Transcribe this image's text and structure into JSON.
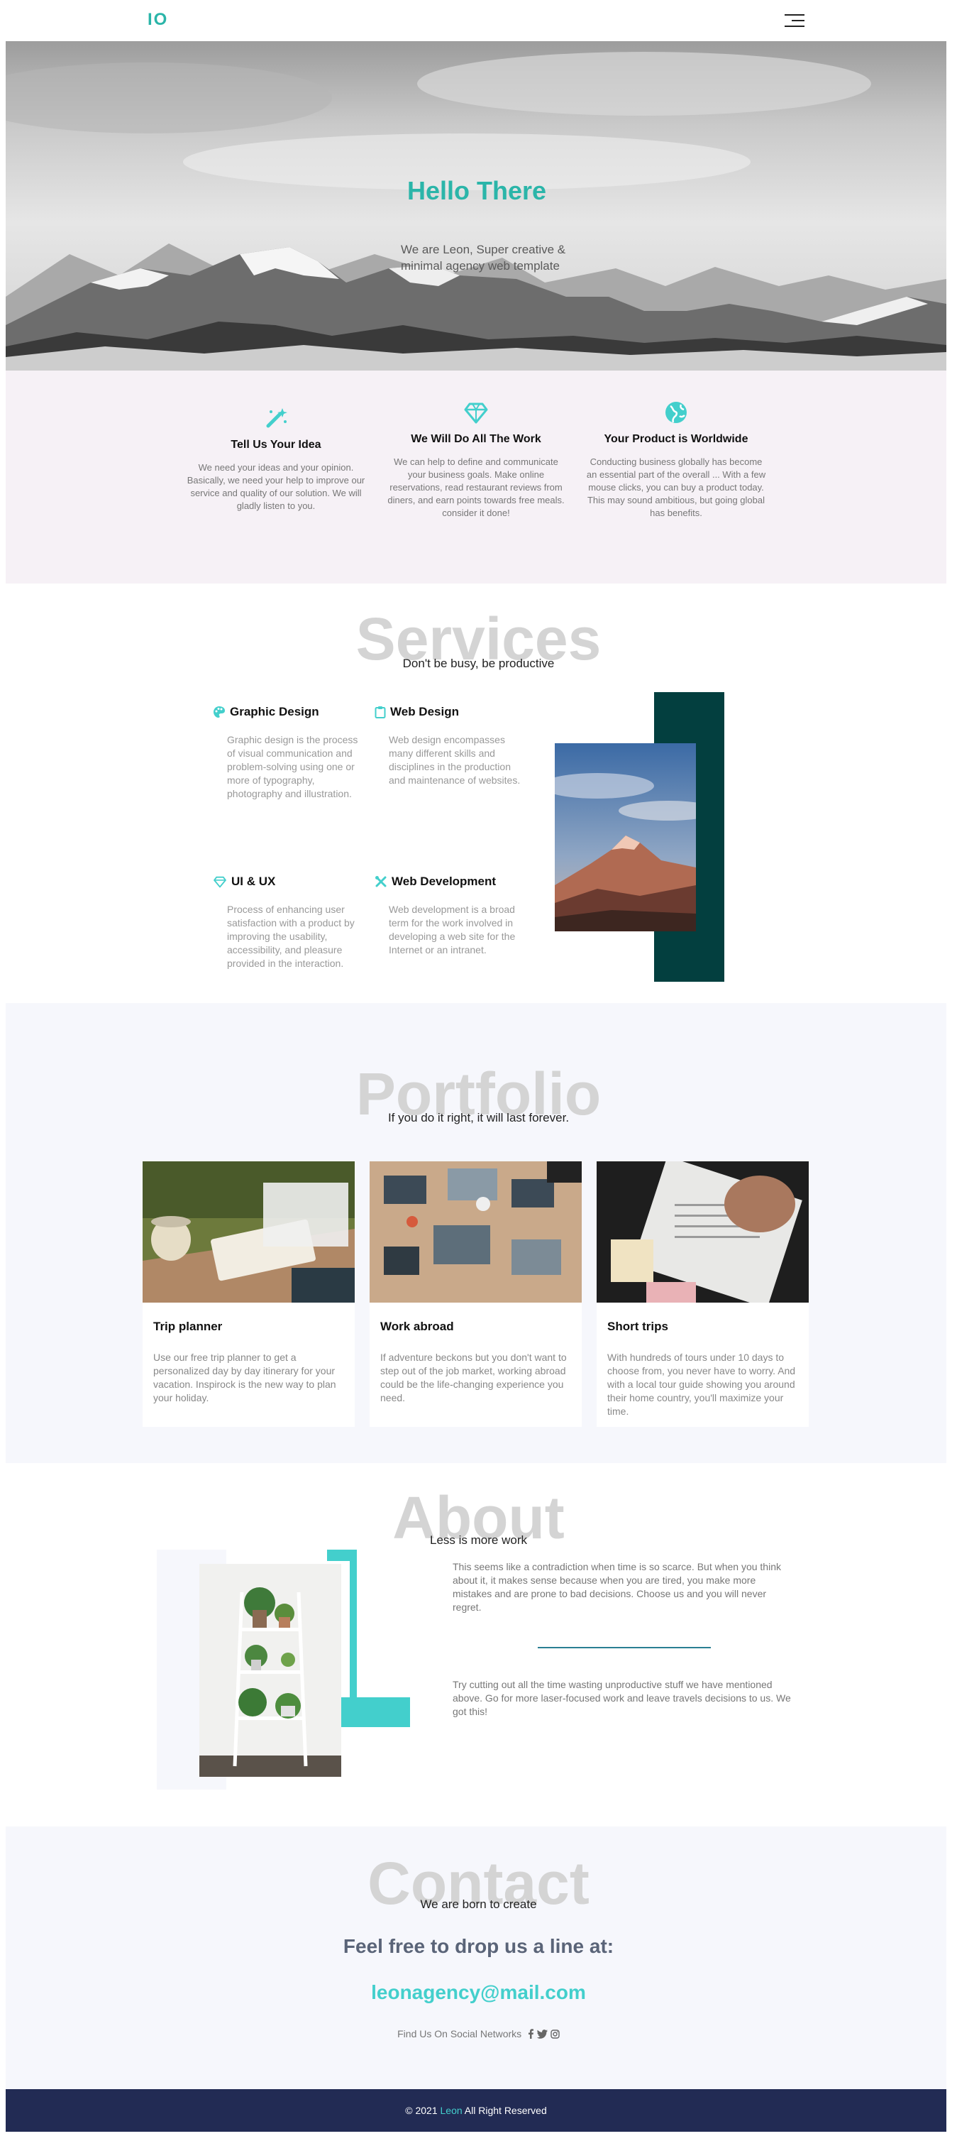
{
  "header": {
    "logo": "IO",
    "menu_icon": "hamburger-menu-icon"
  },
  "hero": {
    "title": "Hello There",
    "subtitle": "We are Leon, Super creative & minimal agency web template"
  },
  "features": [
    {
      "icon": "magic-wand-icon",
      "title": "Tell Us Your Idea",
      "text": "We need your ideas and your opinion. Basically, we need your help to improve our service and quality of our solution. We will gladly listen to you."
    },
    {
      "icon": "diamond-icon",
      "title": "We Will Do All The Work",
      "text": "We can help to define and communicate your business goals. Make online reservations, read restaurant reviews from diners, and earn points towards free meals. consider it done!"
    },
    {
      "icon": "globe-icon",
      "title": "Your Product is Worldwide",
      "text": "Conducting business globally has become an essential part of the overall ... With a few mouse clicks, you can buy a product today. This may sound ambitious, but going global has benefits."
    }
  ],
  "services": {
    "title": "Services",
    "subtitle": "Don't be busy, be productive",
    "items": [
      {
        "icon": "palette-icon",
        "title": "Graphic Design",
        "text": "Graphic design is the process of visual communication and problem-solving using one or more of typography, photography and illustration."
      },
      {
        "icon": "clipboard-icon",
        "title": "Web Design",
        "text": "Web design encompasses many different skills and disciplines in the production and maintenance of websites."
      },
      {
        "icon": "diamond-icon",
        "title": "UI & UX",
        "text": "Process of enhancing user satisfaction with a product by improving the usability, accessibility, and pleasure provided in the interaction."
      },
      {
        "icon": "tools-icon",
        "title": "Web Development",
        "text": "Web development is a broad term for the work involved in developing a web site for the Internet or an intranet."
      }
    ]
  },
  "portfolio": {
    "title": "Portfolio",
    "subtitle": "If you do it right, it will last forever.",
    "cards": [
      {
        "title": "Trip planner",
        "text": "Use our free trip planner to get a personalized day by day itinerary for your vacation. Inspirock is the new way to plan your holiday."
      },
      {
        "title": "Work abroad",
        "text": "If adventure beckons but you don't want to step out of the job market, working abroad could be the life-changing experience you need."
      },
      {
        "title": "Short trips",
        "text": "With hundreds of tours under 10 days to choose from, you never have to worry. And with a local tour guide showing you around their home country, you'll maximize your time."
      }
    ]
  },
  "about": {
    "title": "About",
    "subtitle": "Less is more work",
    "para1": "This seems like a contradiction when time is so scarce. But when you think about it, it makes sense because when you are tired, you make more mistakes and are prone to bad decisions. Choose us and you will never regret.",
    "para2": "Try cutting out all the time wasting unproductive stuff we have mentioned above. Go for more laser-focused work and leave travels decisions to us. We got this!"
  },
  "contact": {
    "title": "Contact",
    "subtitle": "We are born to create",
    "line": "Feel free to drop us a line at:",
    "email": "leonagency@mail.com",
    "social_label": "Find Us On Social Networks",
    "social_icons": [
      "facebook-icon",
      "twitter-icon",
      "instagram-icon"
    ]
  },
  "footer": {
    "prefix": "© 2021",
    "brand": "Leon",
    "suffix": "All Right Reserved"
  },
  "colors": {
    "accent": "#2bb5a9",
    "accent_light": "#43cfcc",
    "dark_teal": "#033f3f",
    "footer_bg": "#222b54"
  }
}
